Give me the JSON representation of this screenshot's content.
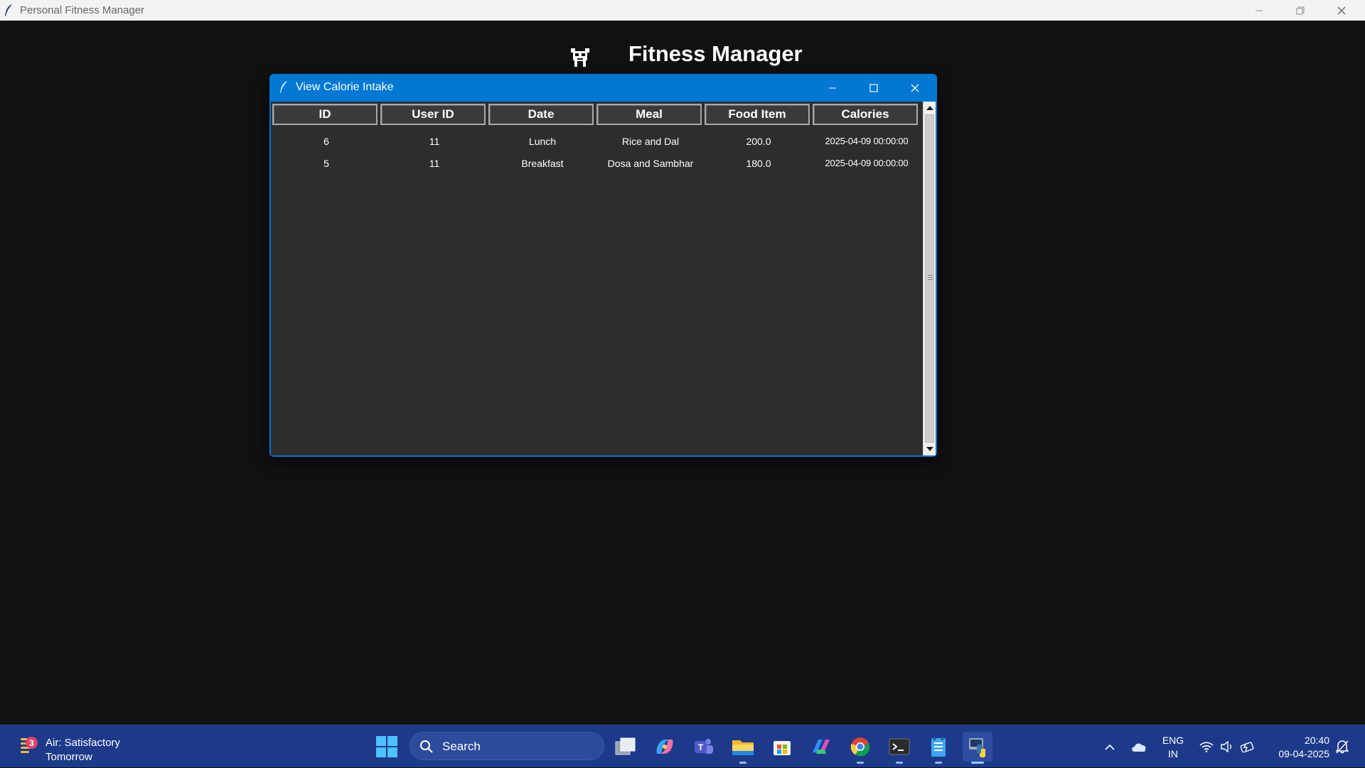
{
  "main_window": {
    "title": "Personal Fitness Manager"
  },
  "app": {
    "heading": "Fitness Manager",
    "logo_icon": "dumbbell-robot-icon"
  },
  "dialog": {
    "title": "View Calorie Intake",
    "columns": [
      "ID",
      "User ID",
      "Date",
      "Meal",
      "Food Item",
      "Calories"
    ],
    "rows": [
      [
        "6",
        "11",
        "Lunch",
        "Rice and Dal",
        "200.0",
        "2025-04-09 00:00:00"
      ],
      [
        "5",
        "11",
        "Breakfast",
        "Dosa and Sambhar",
        "180.0",
        "2025-04-09 00:00:00"
      ]
    ]
  },
  "taskbar": {
    "weather": {
      "badge": "3",
      "line1": "Air: Satisfactory",
      "line2": "Tomorrow"
    },
    "search_placeholder": "Search",
    "apps": [
      "task-view",
      "copilot",
      "teams",
      "file-explorer",
      "microsoft-store",
      "microsoft-365",
      "chrome",
      "terminal",
      "notepad",
      "python"
    ],
    "language": {
      "line1": "ENG",
      "line2": "IN"
    },
    "clock": {
      "time": "20:40",
      "date": "09-04-2025"
    }
  },
  "colors": {
    "accent": "#0078d4",
    "background": "#111111",
    "table_bg": "#2d2d2d",
    "taskbar": "#1d3a8a"
  }
}
